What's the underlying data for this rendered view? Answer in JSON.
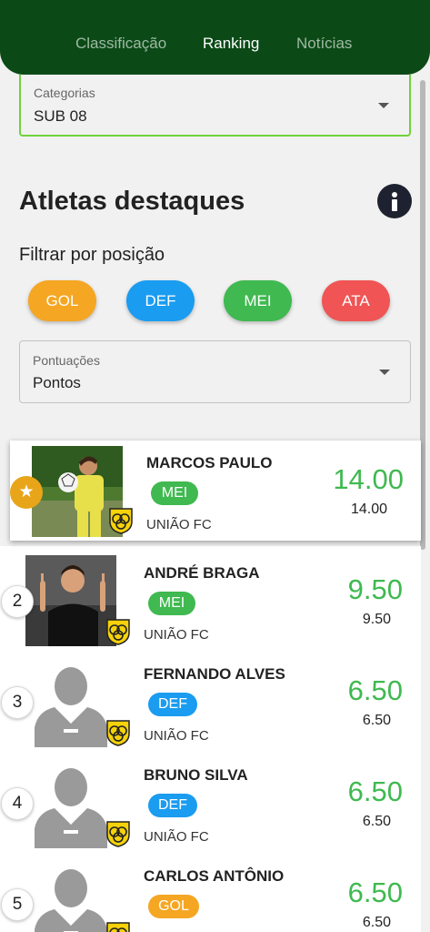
{
  "nav": {
    "tabs": [
      {
        "label": "Classificação",
        "active": false
      },
      {
        "label": "Ranking",
        "active": true
      },
      {
        "label": "Notícias",
        "active": false
      }
    ]
  },
  "category": {
    "label": "Categorias",
    "value": "SUB 08"
  },
  "section": {
    "title": "Atletas destaques",
    "info_icon": "info-icon"
  },
  "filter": {
    "label": "Filtrar por posição",
    "positions": [
      {
        "label": "GOL",
        "color": "#f5a623"
      },
      {
        "label": "DEF",
        "color": "#1a9cf0"
      },
      {
        "label": "MEI",
        "color": "#3fb950"
      },
      {
        "label": "ATA",
        "color": "#f05454"
      }
    ]
  },
  "scoring": {
    "label": "Pontuações",
    "value": "Pontos"
  },
  "athletes": [
    {
      "rank": "★",
      "name": "MARCOS PAULO",
      "position": "MEI",
      "position_color": "#3fb950",
      "club": "UNIÃO FC",
      "score": "14.00",
      "subscore": "14.00",
      "photo": "photo"
    },
    {
      "rank": "2",
      "name": "ANDRÉ BRAGA",
      "position": "MEI",
      "position_color": "#3fb950",
      "club": "UNIÃO FC",
      "score": "9.50",
      "subscore": "9.50",
      "photo": "photo"
    },
    {
      "rank": "3",
      "name": "FERNANDO ALVES",
      "position": "DEF",
      "position_color": "#1a9cf0",
      "club": "UNIÃO FC",
      "score": "6.50",
      "subscore": "6.50",
      "photo": "avatar-placeholder"
    },
    {
      "rank": "4",
      "name": "BRUNO SILVA",
      "position": "DEF",
      "position_color": "#1a9cf0",
      "club": "UNIÃO FC",
      "score": "6.50",
      "subscore": "6.50",
      "photo": "avatar-placeholder"
    },
    {
      "rank": "5",
      "name": "CARLOS ANTÔNIO",
      "position": "GOL",
      "position_color": "#f5a623",
      "club": "UNIÃO FC",
      "score": "6.50",
      "subscore": "6.50",
      "photo": "avatar-placeholder"
    }
  ]
}
